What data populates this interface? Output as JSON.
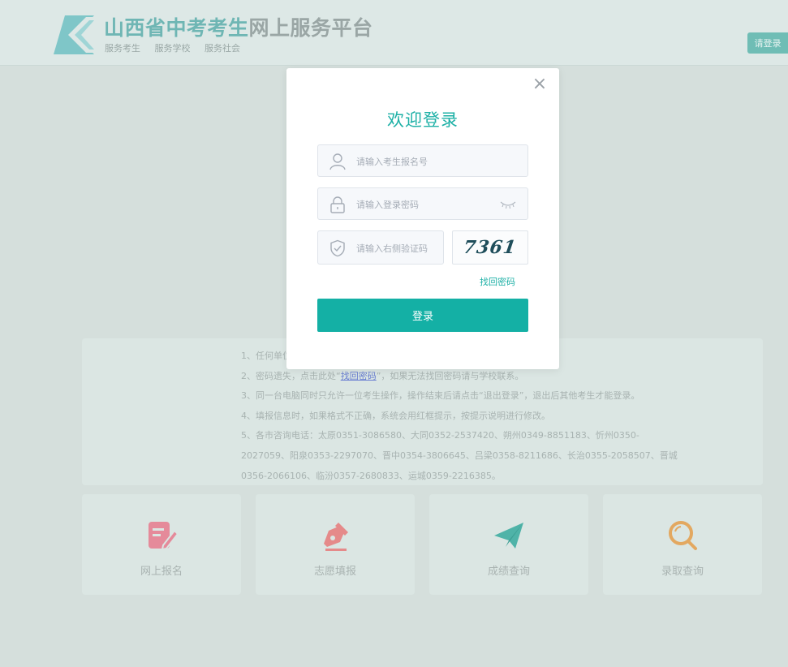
{
  "header": {
    "title_highlight": "山西省中考考生",
    "title_rest": "网上服务平台",
    "subtitles": [
      "服务考生",
      "服务学校",
      "服务社会"
    ],
    "login_button": "请登录"
  },
  "notice": {
    "lines": [
      "1、任何单位",
      "2、密码遗失，点击此处“",
      "3、同一台电脑同时只允许一位考生操作，操作结束后请点击“退出登录”，退出后其他考生才能登录。",
      "4、填报信息时，如果格式不正确，系统会用红框提示，按提示说明进行修改。",
      "5、各市咨询电话：太原0351-3086580、大同0352-2537420、朔州0349-8851183、忻州0350-",
      "2027059、阳泉0353-2297070、晋中0354-3806645、吕梁0358-8211686、长治0355-2058507、晋城",
      "0356-2066106、临汾0357-2680833、运城0359-2216385。"
    ],
    "line2_link": "找回密码",
    "line2_tail": "”，如果无法找回密码请与学校联系。"
  },
  "cards": [
    {
      "label": "网上报名",
      "color": "#e58a9a"
    },
    {
      "label": "志愿填报",
      "color": "#e58a8a"
    },
    {
      "label": "成绩查询",
      "color": "#4fb3a8"
    },
    {
      "label": "录取查询",
      "color": "#e3a860"
    }
  ],
  "modal": {
    "title": "欢迎登录",
    "close": "×",
    "username_placeholder": "请输入考生报名号",
    "password_placeholder": "请输入登录密码",
    "captcha_placeholder": "请输入右侧验证码",
    "captcha_text": "7361",
    "forgot_link": "找回密码",
    "submit_label": "登录"
  },
  "colors": {
    "accent": "#14b0a5",
    "overlay_bg": "#d5dfdc"
  }
}
